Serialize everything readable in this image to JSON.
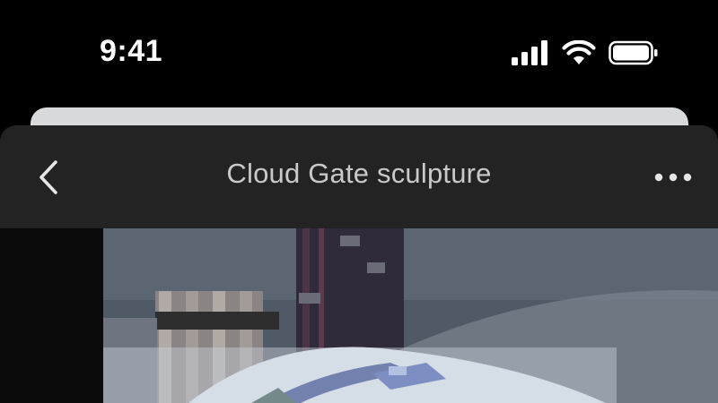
{
  "status_bar": {
    "time": "9:41",
    "icons": [
      "cellular-signal-icon",
      "wifi-icon",
      "battery-icon"
    ]
  },
  "nav": {
    "title": "Cloud Gate sculpture",
    "back_icon": "chevron-left-icon",
    "more_icon": "ellipsis-icon"
  },
  "colors": {
    "background": "#000000",
    "sheet": "#111111",
    "nav_bar": "#232323",
    "title_text": "#c9c9c9",
    "peek_card": "#d8d9db"
  }
}
